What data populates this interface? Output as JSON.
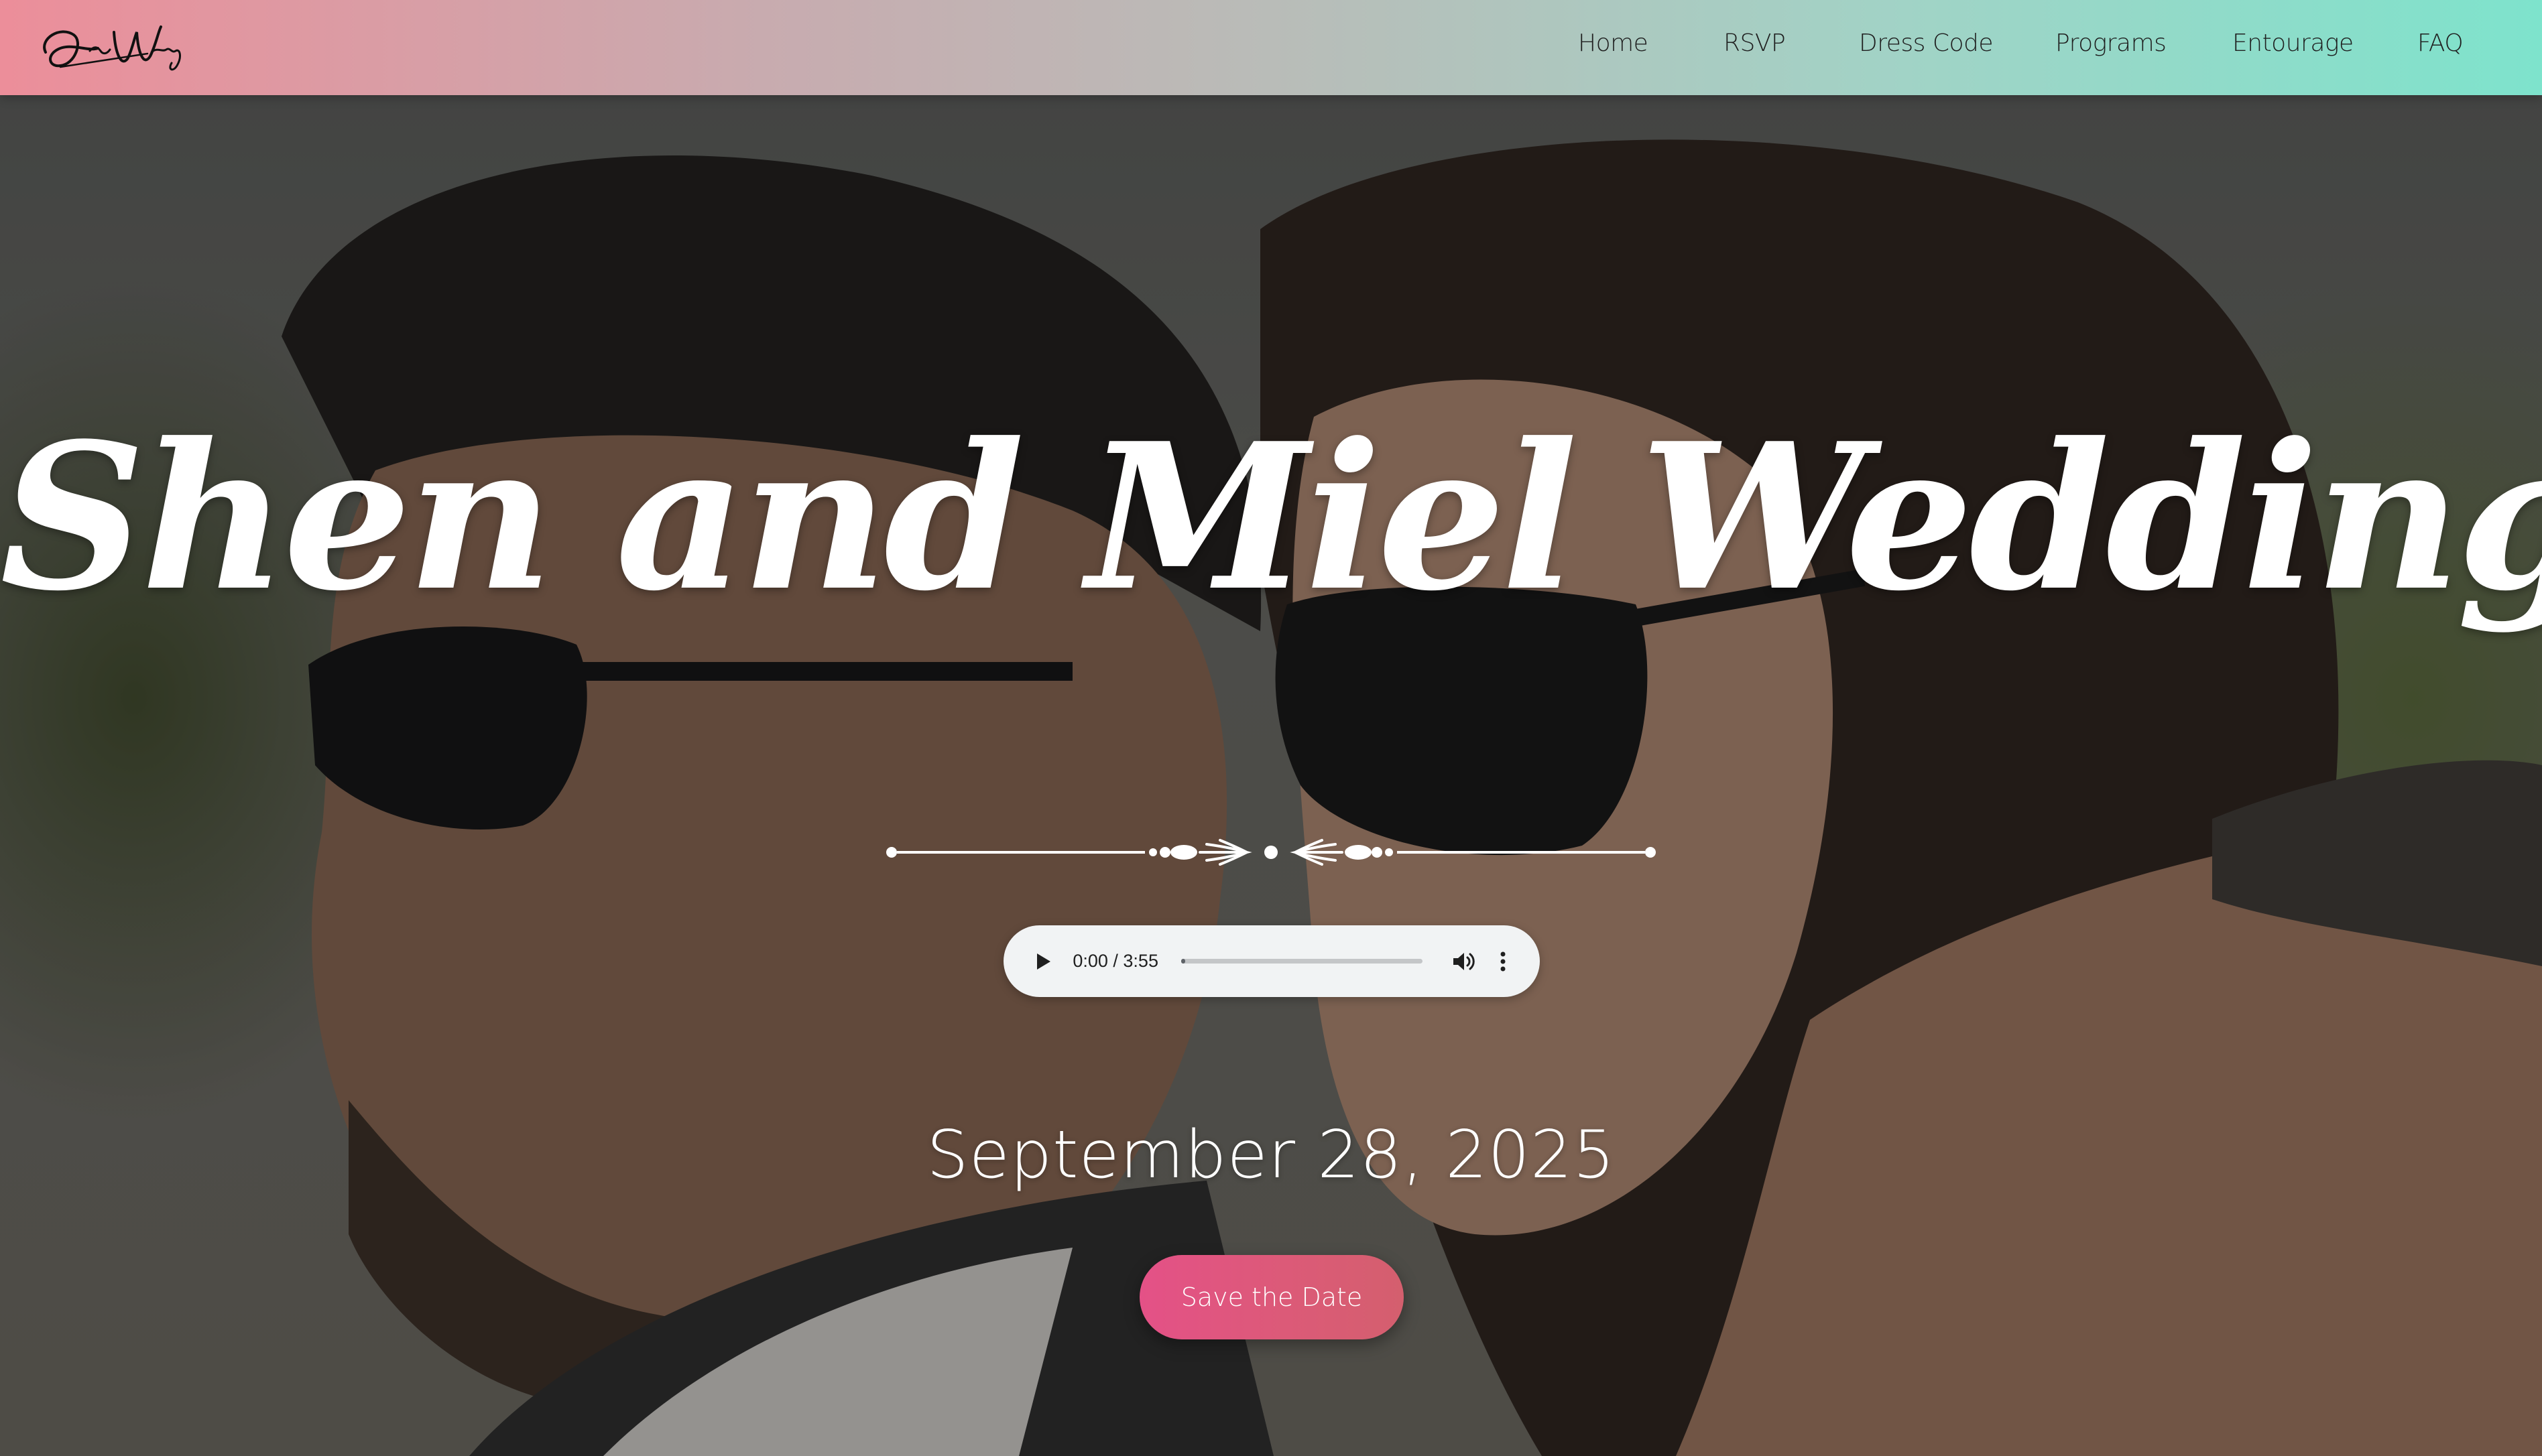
{
  "header": {
    "logo_alt": "Our Wedding",
    "nav": [
      {
        "label": "Home"
      },
      {
        "label": "RSVP"
      },
      {
        "label": "Dress Code"
      },
      {
        "label": "Programs"
      },
      {
        "label": "Entourage"
      },
      {
        "label": "FAQ"
      }
    ]
  },
  "hero": {
    "title": "Shen and Miel Wedding",
    "audio": {
      "time": "0:00 / 3:55",
      "progress": 0.0
    },
    "date": "September 28, 2025",
    "cta_label": "Save the Date",
    "accent_gradient": [
      "#e45187",
      "#d45f6e"
    ]
  },
  "colors": {
    "nav_gradient_left": "#ec8e9a",
    "nav_gradient_right": "#7ee3cc",
    "title": "#ffffff"
  },
  "icons": {
    "logo": "signature-logo",
    "play": "play-icon",
    "volume": "volume-icon",
    "more": "more-vertical-icon",
    "divider": "ornamental-divider"
  }
}
